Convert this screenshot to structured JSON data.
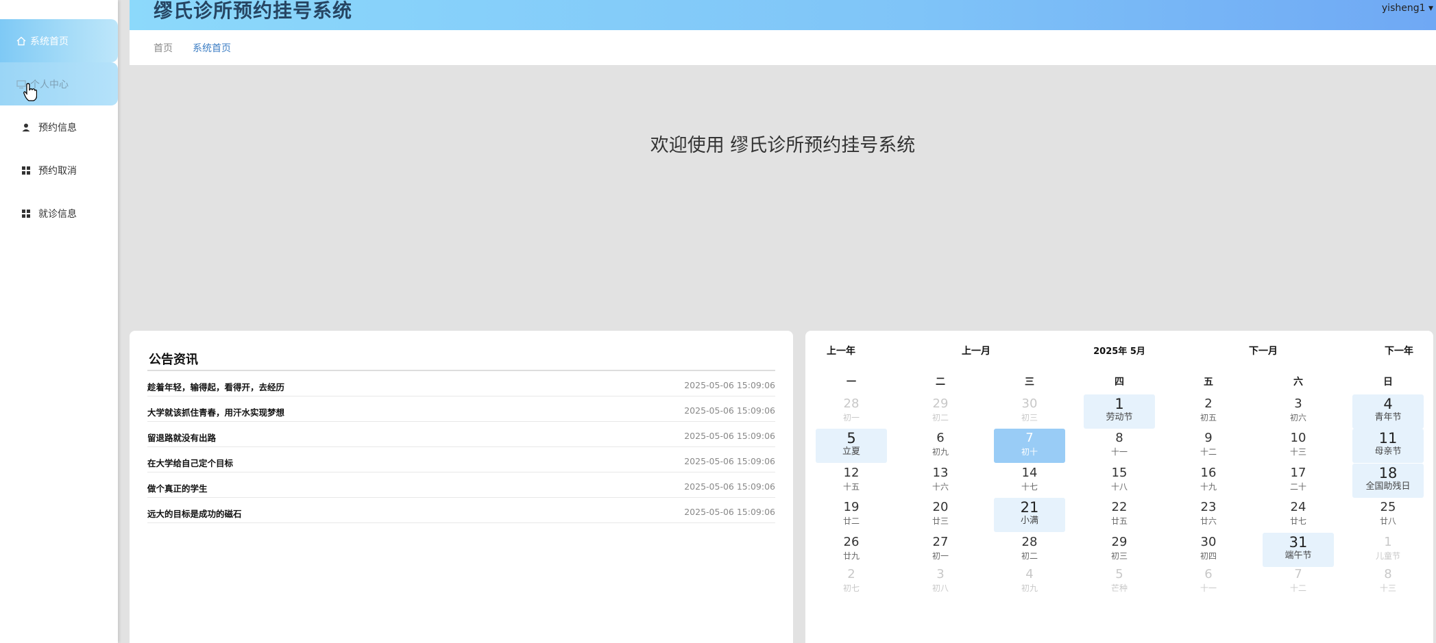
{
  "app": {
    "title": "缪氏诊所预约挂号系统",
    "user": "yisheng1 ▾"
  },
  "sidebar": {
    "items": [
      {
        "label": "系统首页",
        "icon": "home-icon"
      },
      {
        "label": "个人中心",
        "icon": "monitor-icon"
      },
      {
        "label": "预约信息",
        "icon": "person-icon"
      },
      {
        "label": "预约取消",
        "icon": "grid-icon"
      },
      {
        "label": "就诊信息",
        "icon": "grid-icon"
      }
    ]
  },
  "breadcrumb": {
    "home": "首页",
    "current": "系统首页"
  },
  "welcome": "欢迎使用 缪氏诊所预约挂号系统",
  "notice": {
    "title": "公告资讯",
    "items": [
      {
        "title": "趁着年轻，输得起，看得开，去经历",
        "date": "2025-05-06 15:09:06"
      },
      {
        "title": "大学就该抓住青春，用汗水实现梦想",
        "date": "2025-05-06 15:09:06"
      },
      {
        "title": "留退路就没有出路",
        "date": "2025-05-06 15:09:06"
      },
      {
        "title": "在大学给自己定个目标",
        "date": "2025-05-06 15:09:06"
      },
      {
        "title": "做个真正的学生",
        "date": "2025-05-06 15:09:06"
      },
      {
        "title": "远大的目标是成功的磁石",
        "date": "2025-05-06 15:09:06"
      }
    ]
  },
  "calendar": {
    "prev_year": "上一年",
    "prev_month": "上一月",
    "current": "2025年 5月",
    "next_month": "下一月",
    "next_year": "下一年",
    "weekdays": [
      "一",
      "二",
      "三",
      "四",
      "五",
      "六",
      "日"
    ],
    "weeks": [
      [
        {
          "d": "28",
          "l": "初一",
          "o": true
        },
        {
          "d": "29",
          "l": "初二",
          "o": true
        },
        {
          "d": "30",
          "l": "初三",
          "o": true
        },
        {
          "d": "1",
          "l": "劳动节",
          "h": true
        },
        {
          "d": "2",
          "l": "初五"
        },
        {
          "d": "3",
          "l": "初六"
        },
        {
          "d": "4",
          "l": "青年节",
          "h": true
        }
      ],
      [
        {
          "d": "5",
          "l": "立夏",
          "h": true
        },
        {
          "d": "6",
          "l": "初九"
        },
        {
          "d": "7",
          "l": "初十",
          "s": true
        },
        {
          "d": "8",
          "l": "十一"
        },
        {
          "d": "9",
          "l": "十二"
        },
        {
          "d": "10",
          "l": "十三"
        },
        {
          "d": "11",
          "l": "母亲节",
          "h": true
        }
      ],
      [
        {
          "d": "12",
          "l": "十五"
        },
        {
          "d": "13",
          "l": "十六"
        },
        {
          "d": "14",
          "l": "十七"
        },
        {
          "d": "15",
          "l": "十八"
        },
        {
          "d": "16",
          "l": "十九"
        },
        {
          "d": "17",
          "l": "二十"
        },
        {
          "d": "18",
          "l": "全国助残日",
          "h": true
        }
      ],
      [
        {
          "d": "19",
          "l": "廿二"
        },
        {
          "d": "20",
          "l": "廿三"
        },
        {
          "d": "21",
          "l": "小满",
          "h": true
        },
        {
          "d": "22",
          "l": "廿五"
        },
        {
          "d": "23",
          "l": "廿六"
        },
        {
          "d": "24",
          "l": "廿七"
        },
        {
          "d": "25",
          "l": "廿八"
        }
      ],
      [
        {
          "d": "26",
          "l": "廿九"
        },
        {
          "d": "27",
          "l": "初一"
        },
        {
          "d": "28",
          "l": "初二"
        },
        {
          "d": "29",
          "l": "初三"
        },
        {
          "d": "30",
          "l": "初四"
        },
        {
          "d": "31",
          "l": "端午节",
          "h": true
        },
        {
          "d": "1",
          "l": "儿童节",
          "o": true
        }
      ],
      [
        {
          "d": "2",
          "l": "初七",
          "o": true
        },
        {
          "d": "3",
          "l": "初八",
          "o": true
        },
        {
          "d": "4",
          "l": "初九",
          "o": true
        },
        {
          "d": "5",
          "l": "芒种",
          "o": true
        },
        {
          "d": "6",
          "l": "十一",
          "o": true
        },
        {
          "d": "7",
          "l": "十二",
          "o": true
        },
        {
          "d": "8",
          "l": "十三",
          "o": true
        }
      ]
    ]
  },
  "colors": {
    "accent": "#3d7ec4",
    "header_start": "#8cd9fb",
    "header_end": "#6fa8f4",
    "selected_day": "#99ccf6",
    "holiday_bg": "#e6f2fc"
  }
}
